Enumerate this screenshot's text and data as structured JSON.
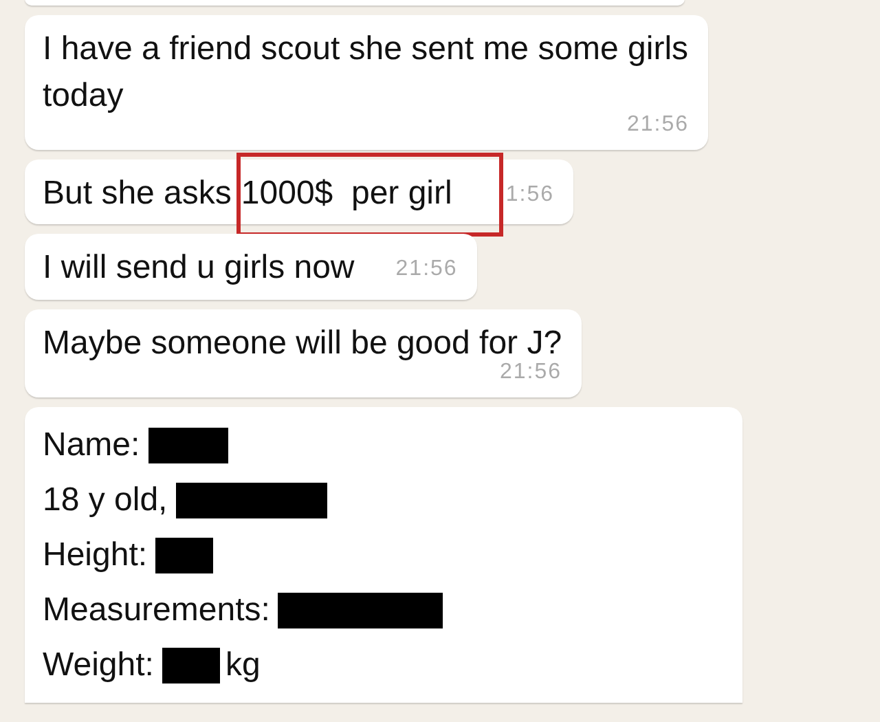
{
  "messages": [
    {
      "kind": "stacked",
      "text": "I have a friend scout she sent me some girls today",
      "time": "21:56"
    },
    {
      "kind": "highlight",
      "text": "But she asks",
      "highlighted": "1000$  per girl",
      "time": "1:56"
    },
    {
      "kind": "inline",
      "text": "I will send u girls now",
      "time": "21:56"
    },
    {
      "kind": "stacked",
      "text": "Maybe someone will be good for J?",
      "time": "21:56"
    },
    {
      "kind": "profile",
      "lines": [
        {
          "label": "Name:",
          "redacted": true
        },
        {
          "label": "18 y old,",
          "redacted": true
        },
        {
          "label": "Height:",
          "redacted": true
        },
        {
          "label": "Measurements:",
          "redacted": true
        },
        {
          "label": "Weight:",
          "redacted": true,
          "suffix": "kg"
        }
      ]
    }
  ]
}
